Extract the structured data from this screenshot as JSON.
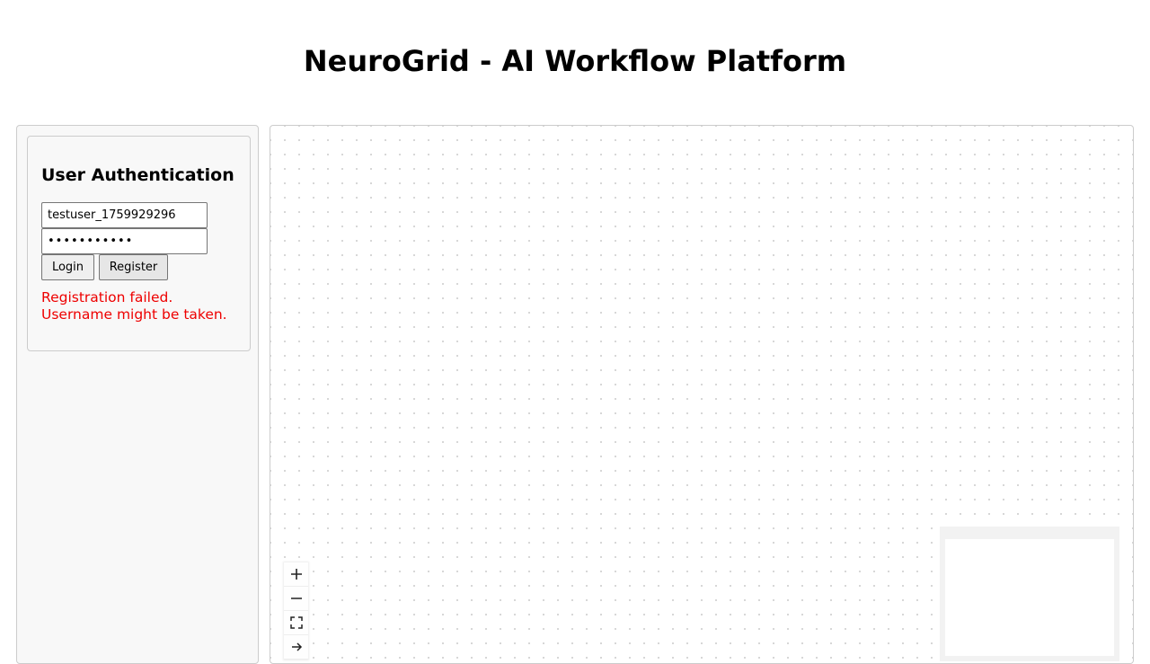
{
  "header": {
    "title": "NeuroGrid - AI Workflow Platform"
  },
  "auth": {
    "heading": "User Authentication",
    "username_value": "testuser_1759929296",
    "password_value": "•••••••••••",
    "login_label": "Login",
    "register_label": "Register",
    "error_line1": "Registration failed.",
    "error_line2": "Username might be taken.",
    "error_color": "#ee0000"
  },
  "canvas": {
    "controls": [
      {
        "name": "zoom-in-button",
        "icon": "plus-icon",
        "glyph": "+"
      },
      {
        "name": "zoom-out-button",
        "icon": "minus-icon",
        "glyph": "−"
      },
      {
        "name": "fit-view-button",
        "icon": "fit-view-icon",
        "glyph": "⛶"
      },
      {
        "name": "interactivity-toggle-button",
        "icon": "arrow-icon",
        "glyph": "→"
      }
    ]
  }
}
